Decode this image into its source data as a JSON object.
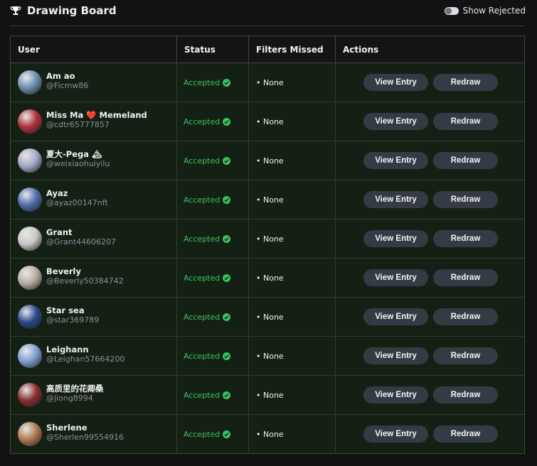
{
  "header": {
    "title": "Drawing Board",
    "toggle_label": "Show Rejected"
  },
  "table": {
    "columns": [
      "User",
      "Status",
      "Filters Missed",
      "Actions"
    ],
    "rows": [
      {
        "name": "Am ao",
        "handle": "@Ficmw86",
        "status": "Accepted",
        "filters": "• None",
        "avatar_color": "#6b8fb0"
      },
      {
        "name": "Miss Ma ❤️ Memeland",
        "handle": "@cdtr65777857",
        "status": "Accepted",
        "filters": "• None",
        "avatar_color": "#b0333d"
      },
      {
        "name": "夏大-Pega 🏔",
        "handle": "@weixiaohuiyilu",
        "status": "Accepted",
        "filters": "• None",
        "avatar_color": "#a6a8c8"
      },
      {
        "name": "Ayaz",
        "handle": "@ayaz00147nft",
        "status": "Accepted",
        "filters": "• None",
        "avatar_color": "#4f6fa8"
      },
      {
        "name": "Grant",
        "handle": "@Grant44606207",
        "status": "Accepted",
        "filters": "• None",
        "avatar_color": "#c8c8c8"
      },
      {
        "name": "Beverly",
        "handle": "@Beverly50384742",
        "status": "Accepted",
        "filters": "• None",
        "avatar_color": "#b8aea0"
      },
      {
        "name": "Star sea",
        "handle": "@star369789",
        "status": "Accepted",
        "filters": "• None",
        "avatar_color": "#2a4a8a"
      },
      {
        "name": "Leighann",
        "handle": "@Leighan57664200",
        "status": "Accepted",
        "filters": "• None",
        "avatar_color": "#7fa0d0"
      },
      {
        "name": "高质里的花卿桑",
        "handle": "@jiong8994",
        "status": "Accepted",
        "filters": "• None",
        "avatar_color": "#8a2f2f"
      },
      {
        "name": "Sherlene",
        "handle": "@Sherlen99554916",
        "status": "Accepted",
        "filters": "• None",
        "avatar_color": "#b07a55"
      }
    ],
    "actions": {
      "view_label": "View Entry",
      "redraw_label": "Redraw"
    }
  },
  "colors": {
    "accent_green": "#3cc25a",
    "button_bg": "#353b45",
    "row_bg": "#152015"
  }
}
